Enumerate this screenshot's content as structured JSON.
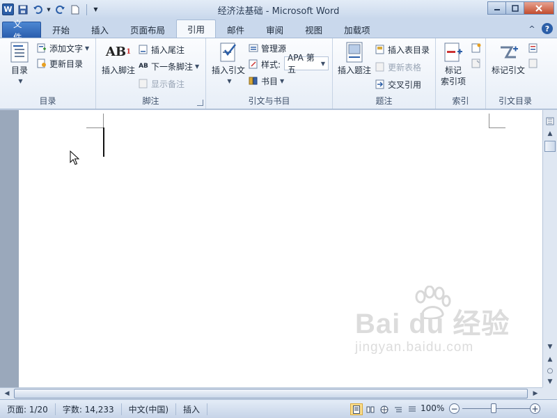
{
  "window": {
    "title": "经济法基础 - Microsoft Word",
    "app_logo": "W"
  },
  "qat": {
    "icons": [
      "word-logo-icon",
      "save-icon",
      "undo-icon",
      "redo-icon",
      "new-document-icon",
      "customize-qat-icon"
    ]
  },
  "tabs": [
    {
      "label": "文件",
      "type": "file"
    },
    {
      "label": "开始"
    },
    {
      "label": "插入"
    },
    {
      "label": "页面布局"
    },
    {
      "label": "引用",
      "active": true
    },
    {
      "label": "邮件"
    },
    {
      "label": "审阅"
    },
    {
      "label": "视图"
    },
    {
      "label": "加载项"
    }
  ],
  "ribbon": {
    "toc": {
      "group_label": "目录",
      "toc_button": "目录",
      "add_text": "添加文字",
      "update_toc": "更新目录"
    },
    "footnotes": {
      "group_label": "脚注",
      "insert_footnote": "插入脚注",
      "insert_footnote_glyph": "AB",
      "insert_footnote_sup": "1",
      "insert_endnote": "插入尾注",
      "next_footnote": "下一条脚注",
      "show_notes": "显示备注"
    },
    "citations": {
      "group_label": "引文与书目",
      "insert_citation": "插入引文",
      "manage_sources": "管理源",
      "style_label": "样式:",
      "style_value": "APA 第五",
      "bibliography": "书目"
    },
    "captions": {
      "group_label": "题注",
      "insert_caption": "插入题注",
      "insert_table_of_figures": "插入表目录",
      "update_table": "更新表格",
      "cross_reference": "交叉引用"
    },
    "index": {
      "group_label": "索引",
      "mark_entry_line1": "标记",
      "mark_entry_line2": "索引项"
    },
    "toa": {
      "group_label": "引文目录",
      "mark_citation": "标记引文"
    }
  },
  "statusbar": {
    "page": "页面: 1/20",
    "word_count": "字数: 14,233",
    "language": "中文(中国)",
    "mode": "插入",
    "zoom": "100%",
    "zoom_minus": "−",
    "zoom_plus": "+"
  },
  "watermark": {
    "main": "Bai du 经验",
    "sub": "jingyan.baidu.com"
  },
  "colors": {
    "file_tab": "#2a5eae",
    "ribbon_bg": "#f5f8fc",
    "frame": "#c6d3e4",
    "close_button": "#c24c2e"
  }
}
